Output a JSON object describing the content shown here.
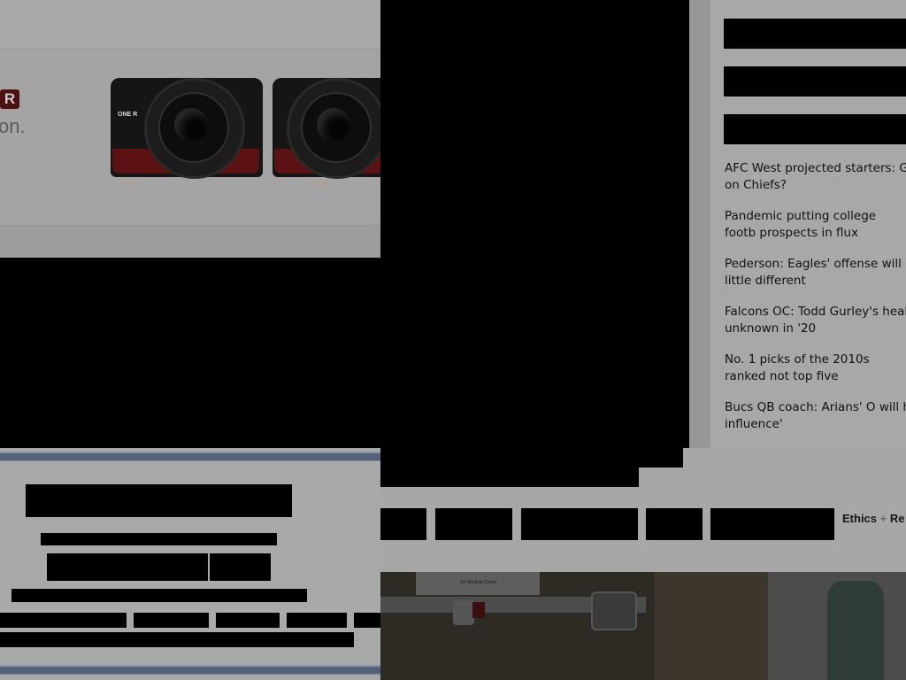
{
  "ad": {
    "brand_badge": "R",
    "tagline": "on.",
    "camera_model_1": "ONE R",
    "camera_label_1": "Insta360",
    "camera_label_2": "Insta360"
  },
  "headlines": [
    {
      "text": "AFC West projected starters: G on Chiefs?"
    },
    {
      "text": "Pandemic putting college footb prospects in flux"
    },
    {
      "text": "Pederson: Eagles' offense will little different"
    },
    {
      "text": "Falcons OC: Todd Gurley's heal unknown in '20"
    },
    {
      "text": "No. 1 picks of the 2010s ranked not top five"
    },
    {
      "text": "Bucs QB coach: Arians' O will h influence'"
    }
  ],
  "nav": {
    "ethics_label": "Ethics",
    "plus": "+",
    "next_label": "Re"
  },
  "photo": {
    "sign_text": "SR Medical Center"
  }
}
